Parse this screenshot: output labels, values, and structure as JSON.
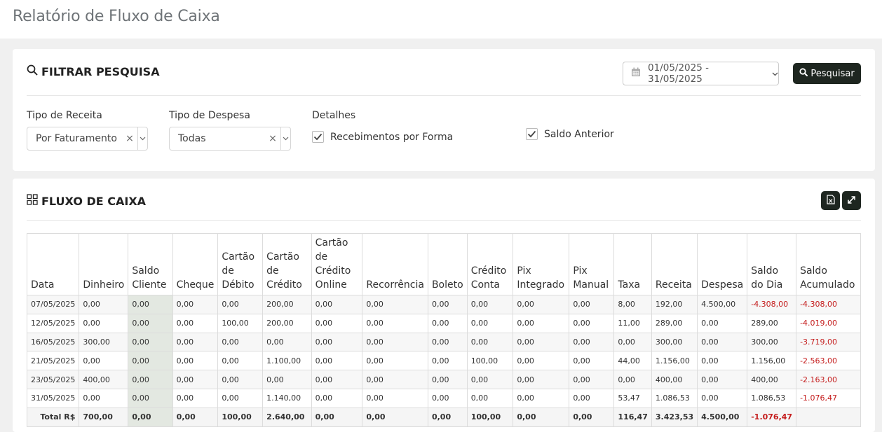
{
  "page": {
    "title": "Relatório de Fluxo de Caixa"
  },
  "filter": {
    "title": "FILTRAR PESQUISA",
    "date_range": "01/05/2025 - 31/05/2025",
    "search_button": "Pesquisar",
    "receita_label": "Tipo de Receita",
    "receita_value": "Por Faturamento",
    "despesa_label": "Tipo de Despesa",
    "despesa_value": "Todas",
    "detalhes_label": "Detalhes",
    "recebimentos_label": "Recebimentos por Forma",
    "recebimentos_checked": true,
    "saldo_anterior_label": "Saldo Anterior",
    "saldo_anterior_checked": true
  },
  "flow": {
    "title": "FLUXO DE CAIXA",
    "export_icon": "excel-export-icon",
    "expand_icon": "expand-icon",
    "columns": [
      [
        "Data"
      ],
      [
        "Dinheiro"
      ],
      [
        "Saldo",
        "Cliente"
      ],
      [
        "Cheque"
      ],
      [
        "Cartão",
        "de",
        "Débito"
      ],
      [
        "Cartão",
        "de",
        "Crédito"
      ],
      [
        "Cartão de",
        "Crédito",
        "Online"
      ],
      [
        "Recorrência"
      ],
      [
        "Boleto"
      ],
      [
        "Crédito",
        "Conta"
      ],
      [
        "Pix",
        "Integrado"
      ],
      [
        "Pix",
        "Manual"
      ],
      [
        "Taxa"
      ],
      [
        "Receita"
      ],
      [
        "Despesa"
      ],
      [
        "Saldo",
        "do Dia"
      ],
      [
        "Saldo",
        "Acumulado"
      ]
    ],
    "rows": [
      [
        "07/05/2025",
        "0,00",
        "0,00",
        "0,00",
        "0,00",
        "200,00",
        "0,00",
        "0,00",
        "0,00",
        "0,00",
        "0,00",
        "0,00",
        "8,00",
        "192,00",
        "4.500,00",
        "-4.308,00",
        "-4.308,00"
      ],
      [
        "12/05/2025",
        "0,00",
        "0,00",
        "0,00",
        "100,00",
        "200,00",
        "0,00",
        "0,00",
        "0,00",
        "0,00",
        "0,00",
        "0,00",
        "11,00",
        "289,00",
        "0,00",
        "289,00",
        "-4.019,00"
      ],
      [
        "16/05/2025",
        "300,00",
        "0,00",
        "0,00",
        "0,00",
        "0,00",
        "0,00",
        "0,00",
        "0,00",
        "0,00",
        "0,00",
        "0,00",
        "0,00",
        "300,00",
        "0,00",
        "300,00",
        "-3.719,00"
      ],
      [
        "21/05/2025",
        "0,00",
        "0,00",
        "0,00",
        "0,00",
        "1.100,00",
        "0,00",
        "0,00",
        "0,00",
        "100,00",
        "0,00",
        "0,00",
        "44,00",
        "1.156,00",
        "0,00",
        "1.156,00",
        "-2.563,00"
      ],
      [
        "23/05/2025",
        "400,00",
        "0,00",
        "0,00",
        "0,00",
        "0,00",
        "0,00",
        "0,00",
        "0,00",
        "0,00",
        "0,00",
        "0,00",
        "0,00",
        "400,00",
        "0,00",
        "400,00",
        "-2.163,00"
      ],
      [
        "31/05/2025",
        "0,00",
        "0,00",
        "0,00",
        "0,00",
        "1.140,00",
        "0,00",
        "0,00",
        "0,00",
        "0,00",
        "0,00",
        "0,00",
        "53,47",
        "1.086,53",
        "0,00",
        "1.086,53",
        "-1.076,47"
      ]
    ],
    "total": [
      "Total R$",
      "700,00",
      "0,00",
      "0,00",
      "100,00",
      "2.640,00",
      "0,00",
      "0,00",
      "0,00",
      "100,00",
      "0,00",
      "0,00",
      "116,47",
      "3.423,53",
      "4.500,00",
      "-1.076,47",
      ""
    ]
  },
  "colors": {
    "dark_button": "#1e2620",
    "negative": "#c41b1b",
    "saldo_cliente_bg": "#e3e8e1"
  }
}
